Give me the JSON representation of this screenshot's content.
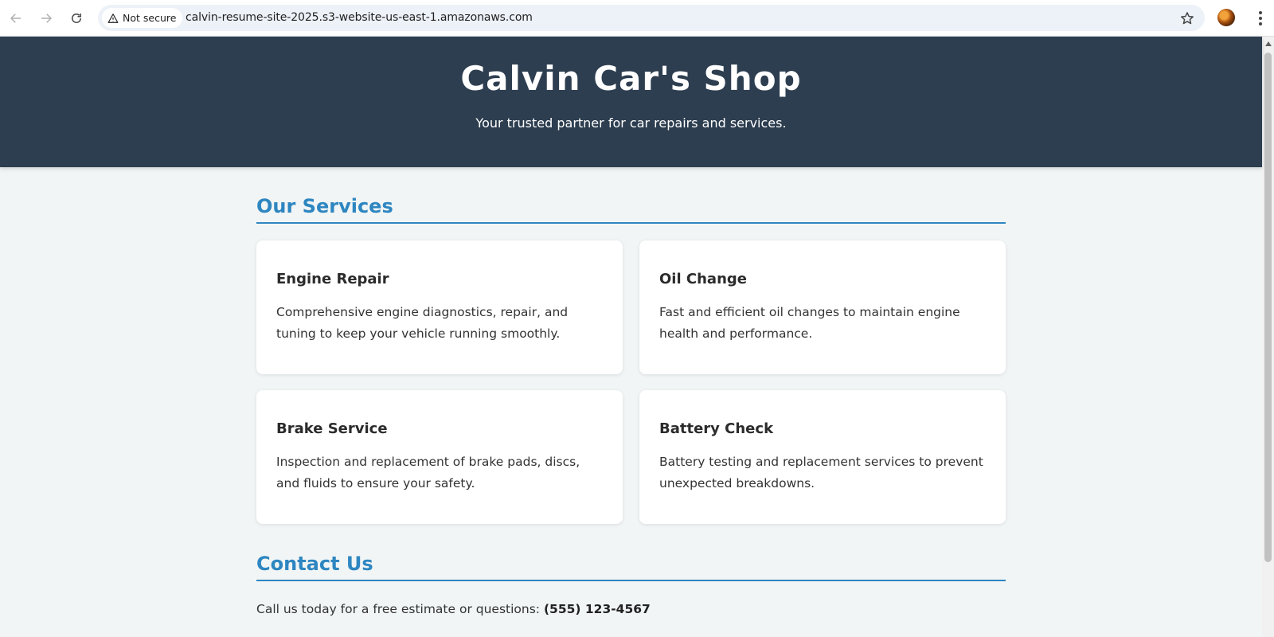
{
  "browser": {
    "security_label": "Not secure",
    "url": "calvin-resume-site-2025.s3-website-us-east-1.amazonaws.com"
  },
  "header": {
    "title": "Calvin Car's Shop",
    "subtitle": "Your trusted partner for car repairs and services."
  },
  "services": {
    "heading": "Our Services",
    "items": [
      {
        "title": "Engine Repair",
        "description": "Comprehensive engine diagnostics, repair, and tuning to keep your vehicle running smoothly."
      },
      {
        "title": "Oil Change",
        "description": "Fast and efficient oil changes to maintain engine health and performance."
      },
      {
        "title": "Brake Service",
        "description": "Inspection and replacement of brake pads, discs, and fluids to ensure your safety."
      },
      {
        "title": "Battery Check",
        "description": "Battery testing and replacement services to prevent unexpected breakdowns."
      }
    ]
  },
  "contact": {
    "heading": "Contact Us",
    "text": "Call us today for a free estimate or questions: ",
    "phone": "(555) 123-4567"
  },
  "colors": {
    "header_bg": "#2d3e50",
    "accent": "#2e86c1",
    "page_bg": "#f1f5f5"
  }
}
